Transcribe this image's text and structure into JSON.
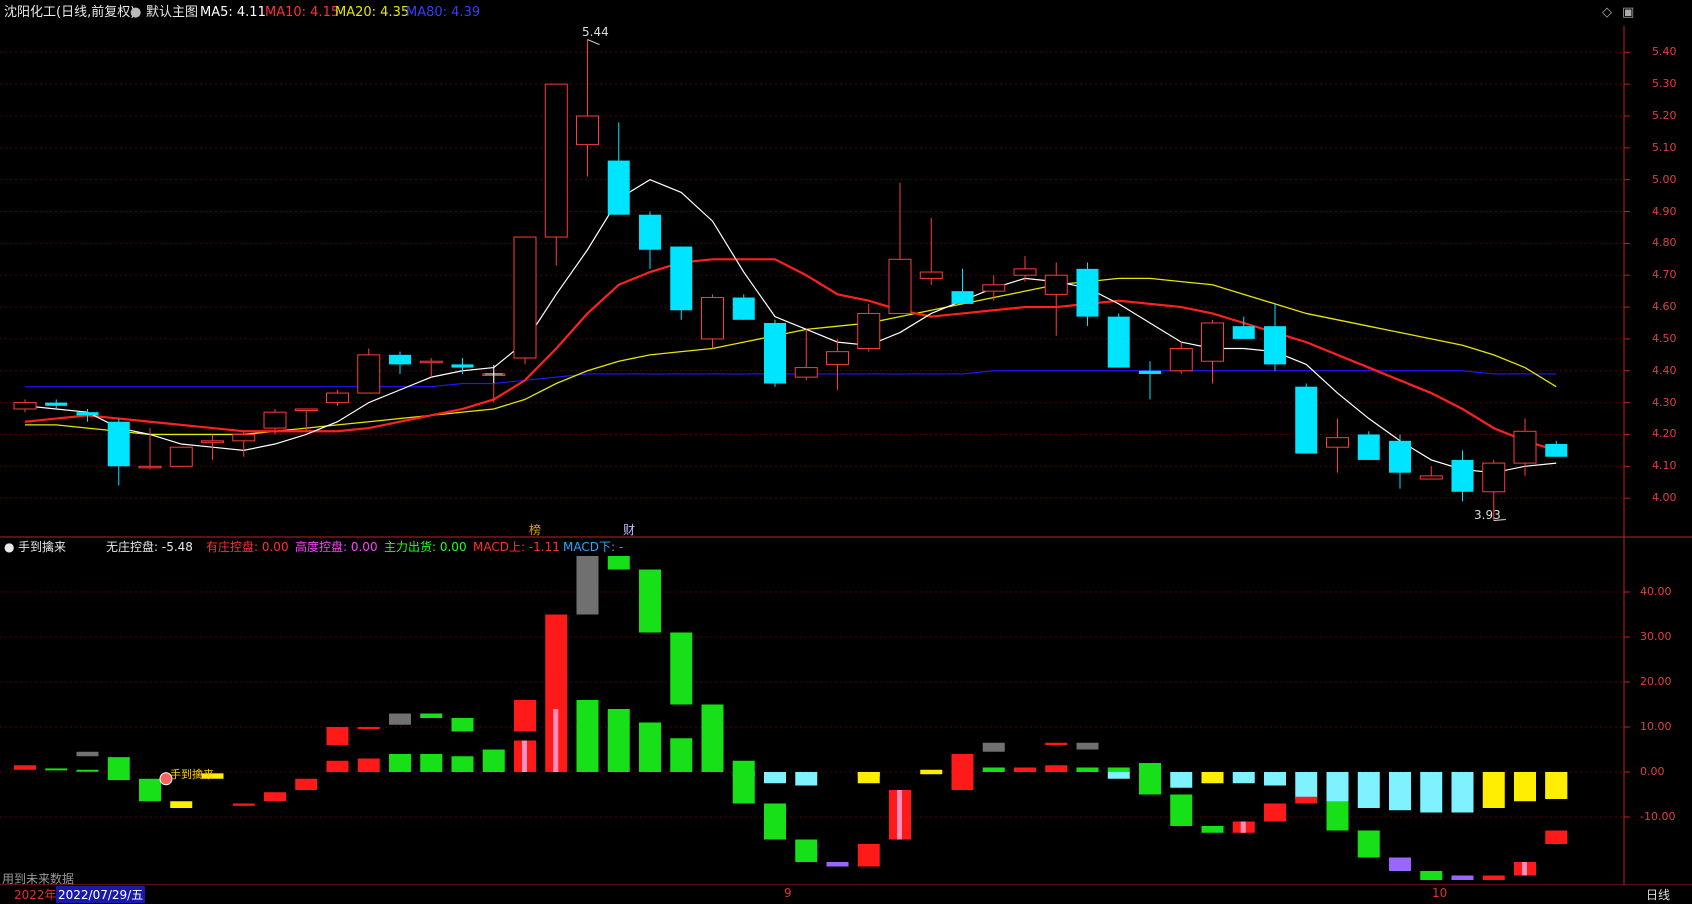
{
  "title_bar": {
    "stock": "沈阳化工(日线,前复权)",
    "main_chart": "默认主图",
    "ma5": "MA5: 4.11",
    "ma10": "MA10: 4.15",
    "ma20": "MA20: 4.35",
    "ma80": "MA80: 4.39"
  },
  "indicator_bar": {
    "name": "手到擒来",
    "wzk": "无庄控盘: -5.48",
    "yzk": "有庄控盘: 0.00",
    "gdk": "高度控盘: 0.00",
    "zlch": "主力出货: 0.00",
    "macd_up": "MACD上: -1.11",
    "macd_down": "MACD下: -"
  },
  "markers": {
    "bang": "榜",
    "cai": "财",
    "high": "5.44",
    "low": "3.93",
    "hand_label": "手到擒来"
  },
  "bottom": {
    "no_future": "用到未来数据",
    "year": "2022年",
    "date": "2022/07/29/五",
    "month9": "9",
    "month10": "10",
    "period": "日线"
  },
  "colors": {
    "up": "#ff3b3b",
    "down": "#00e5ff",
    "ma5": "#ffffff",
    "ma10": "#ff2020",
    "ma20": "#e6e600",
    "ma80": "#1a1aff",
    "axis": "#e04040"
  },
  "chart_data": [
    {
      "type": "candlestick",
      "title": "沈阳化工(日线,前复权)",
      "y_ticks": [
        "5.40",
        "5.30",
        "5.20",
        "5.10",
        "5.00",
        "4.90",
        "4.80",
        "4.70",
        "4.60",
        "4.50",
        "4.40",
        "4.30",
        "4.20",
        "4.10",
        "4.00"
      ],
      "ylim": [
        3.9,
        5.47
      ],
      "candles": [
        {
          "o": 4.28,
          "c": 4.3,
          "h": 4.31,
          "l": 4.27
        },
        {
          "o": 4.3,
          "c": 4.29,
          "h": 4.31,
          "l": 4.28
        },
        {
          "o": 4.27,
          "c": 4.26,
          "h": 4.28,
          "l": 4.24
        },
        {
          "o": 4.24,
          "c": 4.1,
          "h": 4.25,
          "l": 4.04
        },
        {
          "o": 4.1,
          "c": 4.1,
          "h": 4.22,
          "l": 4.09
        },
        {
          "o": 4.1,
          "c": 4.16,
          "h": 4.16,
          "l": 4.1
        },
        {
          "o": 4.18,
          "c": 4.18,
          "h": 4.2,
          "l": 4.12
        },
        {
          "o": 4.18,
          "c": 4.2,
          "h": 4.21,
          "l": 4.13
        },
        {
          "o": 4.22,
          "c": 4.27,
          "h": 4.28,
          "l": 4.2
        },
        {
          "o": 4.28,
          "c": 4.28,
          "h": 4.28,
          "l": 4.21
        },
        {
          "o": 4.3,
          "c": 4.33,
          "h": 4.34,
          "l": 4.29
        },
        {
          "o": 4.33,
          "c": 4.45,
          "h": 4.47,
          "l": 4.33
        },
        {
          "o": 4.45,
          "c": 4.42,
          "h": 4.46,
          "l": 4.39
        },
        {
          "o": 4.43,
          "c": 4.43,
          "h": 4.44,
          "l": 4.38
        },
        {
          "o": 4.42,
          "c": 4.41,
          "h": 4.44,
          "l": 4.39
        },
        {
          "o": 4.39,
          "c": 4.39,
          "h": 4.4,
          "l": 4.3
        },
        {
          "o": 4.44,
          "c": 4.82,
          "h": 4.82,
          "l": 4.42
        },
        {
          "o": 4.82,
          "c": 5.3,
          "h": 5.3,
          "l": 4.73
        },
        {
          "o": 5.11,
          "c": 5.2,
          "h": 5.44,
          "l": 5.01
        },
        {
          "o": 5.06,
          "c": 4.89,
          "h": 5.18,
          "l": 4.89
        },
        {
          "o": 4.89,
          "c": 4.78,
          "h": 4.9,
          "l": 4.72
        },
        {
          "o": 4.79,
          "c": 4.59,
          "h": 4.79,
          "l": 4.56
        },
        {
          "o": 4.5,
          "c": 4.63,
          "h": 4.64,
          "l": 4.47
        },
        {
          "o": 4.63,
          "c": 4.56,
          "h": 4.64,
          "l": 4.56
        },
        {
          "o": 4.55,
          "c": 4.36,
          "h": 4.56,
          "l": 4.35
        },
        {
          "o": 4.38,
          "c": 4.41,
          "h": 4.53,
          "l": 4.37
        },
        {
          "o": 4.42,
          "c": 4.46,
          "h": 4.5,
          "l": 4.34
        },
        {
          "o": 4.47,
          "c": 4.58,
          "h": 4.61,
          "l": 4.46
        },
        {
          "o": 4.58,
          "c": 4.75,
          "h": 4.99,
          "l": 4.58
        },
        {
          "o": 4.69,
          "c": 4.71,
          "h": 4.88,
          "l": 4.67
        },
        {
          "o": 4.65,
          "c": 4.61,
          "h": 4.72,
          "l": 4.61
        },
        {
          "o": 4.65,
          "c": 4.67,
          "h": 4.7,
          "l": 4.62
        },
        {
          "o": 4.7,
          "c": 4.72,
          "h": 4.76,
          "l": 4.68
        },
        {
          "o": 4.64,
          "c": 4.7,
          "h": 4.74,
          "l": 4.51
        },
        {
          "o": 4.72,
          "c": 4.57,
          "h": 4.74,
          "l": 4.54
        },
        {
          "o": 4.57,
          "c": 4.41,
          "h": 4.58,
          "l": 4.41
        },
        {
          "o": 4.4,
          "c": 4.39,
          "h": 4.43,
          "l": 4.31
        },
        {
          "o": 4.4,
          "c": 4.47,
          "h": 4.49,
          "l": 4.39
        },
        {
          "o": 4.43,
          "c": 4.55,
          "h": 4.56,
          "l": 4.36
        },
        {
          "o": 4.54,
          "c": 4.5,
          "h": 4.57,
          "l": 4.5
        },
        {
          "o": 4.54,
          "c": 4.42,
          "h": 4.61,
          "l": 4.4
        },
        {
          "o": 4.35,
          "c": 4.14,
          "h": 4.36,
          "l": 4.14
        },
        {
          "o": 4.16,
          "c": 4.19,
          "h": 4.25,
          "l": 4.08
        },
        {
          "o": 4.2,
          "c": 4.12,
          "h": 4.21,
          "l": 4.12
        },
        {
          "o": 4.18,
          "c": 4.08,
          "h": 4.2,
          "l": 4.03
        },
        {
          "o": 4.06,
          "c": 4.07,
          "h": 4.1,
          "l": 4.06
        },
        {
          "o": 4.12,
          "c": 4.02,
          "h": 4.15,
          "l": 3.99
        },
        {
          "o": 4.02,
          "c": 4.11,
          "h": 4.12,
          "l": 3.93
        },
        {
          "o": 4.11,
          "c": 4.21,
          "h": 4.25,
          "l": 4.07
        },
        {
          "o": 4.17,
          "c": 4.13,
          "h": 4.18,
          "l": 4.13
        }
      ],
      "ma5": [
        4.29,
        4.28,
        4.27,
        4.22,
        4.2,
        4.17,
        4.16,
        4.15,
        4.17,
        4.2,
        4.24,
        4.3,
        4.34,
        4.38,
        4.4,
        4.41,
        4.49,
        4.64,
        4.78,
        4.94,
        5.0,
        4.96,
        4.87,
        4.71,
        4.57,
        4.53,
        4.49,
        4.48,
        4.52,
        4.58,
        4.62,
        4.66,
        4.69,
        4.68,
        4.66,
        4.61,
        4.55,
        4.49,
        4.47,
        4.47,
        4.46,
        4.42,
        4.33,
        4.25,
        4.18,
        4.12,
        4.09,
        4.08,
        4.1,
        4.11
      ],
      "ma10": [
        4.24,
        4.25,
        4.26,
        4.25,
        4.24,
        4.23,
        4.22,
        4.21,
        4.21,
        4.21,
        4.21,
        4.22,
        4.24,
        4.26,
        4.28,
        4.31,
        4.37,
        4.47,
        4.58,
        4.67,
        4.71,
        4.74,
        4.75,
        4.75,
        4.75,
        4.7,
        4.64,
        4.62,
        4.59,
        4.57,
        4.58,
        4.59,
        4.6,
        4.6,
        4.61,
        4.62,
        4.61,
        4.6,
        4.58,
        4.55,
        4.52,
        4.49,
        4.45,
        4.41,
        4.37,
        4.33,
        4.28,
        4.22,
        4.18,
        4.15
      ],
      "ma20": [
        4.23,
        4.23,
        4.22,
        4.21,
        4.2,
        4.2,
        4.2,
        4.2,
        4.21,
        4.22,
        4.23,
        4.24,
        4.25,
        4.26,
        4.27,
        4.28,
        4.31,
        4.36,
        4.4,
        4.43,
        4.45,
        4.46,
        4.47,
        4.49,
        4.51,
        4.53,
        4.54,
        4.55,
        4.57,
        4.59,
        4.61,
        4.63,
        4.65,
        4.67,
        4.68,
        4.69,
        4.69,
        4.68,
        4.67,
        4.64,
        4.61,
        4.58,
        4.56,
        4.54,
        4.52,
        4.5,
        4.48,
        4.45,
        4.41,
        4.35
      ],
      "ma80": [
        4.35,
        4.35,
        4.35,
        4.35,
        4.35,
        4.35,
        4.35,
        4.35,
        4.35,
        4.35,
        4.35,
        4.35,
        4.35,
        4.35,
        4.36,
        4.36,
        4.37,
        4.38,
        4.39,
        4.39,
        4.39,
        4.39,
        4.39,
        4.39,
        4.39,
        4.39,
        4.39,
        4.39,
        4.39,
        4.39,
        4.39,
        4.4,
        4.4,
        4.4,
        4.4,
        4.4,
        4.4,
        4.4,
        4.4,
        4.4,
        4.4,
        4.4,
        4.4,
        4.4,
        4.4,
        4.4,
        4.4,
        4.39,
        4.39,
        4.39
      ]
    },
    {
      "type": "bar",
      "title": "手到擒来",
      "y_ticks": [
        "40.00",
        "30.00",
        "20.00",
        "10.00",
        "0.00",
        "-10.00"
      ],
      "ylim": [
        -24,
        48
      ],
      "bars": [
        {
          "v0": 0.5,
          "v1": 1.5,
          "c": "red"
        },
        {
          "v0": 0.5,
          "v1": 0.8,
          "c": "green"
        },
        {
          "v0": 0.3,
          "v1": 0.5,
          "c": "green"
        },
        {
          "v0": -1.8,
          "v1": 3.3,
          "c": "green"
        },
        {
          "v0": -6.5,
          "v1": -1.5,
          "c": "green"
        },
        {
          "v0": -8,
          "v1": -6.5,
          "c": "yellow"
        },
        {
          "v0": -0.3,
          "v1": -1.5,
          "c": "yellow"
        },
        {
          "v0": -7.5,
          "v1": -7,
          "c": "red"
        },
        {
          "v0": -6.5,
          "v1": -4.5,
          "c": "red"
        },
        {
          "v0": -4,
          "v1": -1.5,
          "c": "red"
        },
        {
          "v0": 0,
          "v1": 2.5,
          "c": "red"
        },
        {
          "v0": 0,
          "v1": 3,
          "c": "red"
        },
        {
          "v0": 0,
          "v1": 4,
          "c": "green"
        },
        {
          "v0": 0,
          "v1": 4,
          "c": "green"
        },
        {
          "v0": 0,
          "v1": 3.5,
          "c": "green"
        },
        {
          "v0": 0,
          "v1": 5,
          "c": "green"
        },
        {
          "v0": 0,
          "v1": 7,
          "c": "red"
        },
        {
          "v0": 0,
          "v1": 14,
          "c": "red"
        },
        {
          "v0": 0,
          "v1": 16,
          "c": "green"
        },
        {
          "v0": 0,
          "v1": 14,
          "c": "green"
        },
        {
          "v0": 0,
          "v1": 11,
          "c": "green"
        },
        {
          "v0": 0,
          "v1": 7.5,
          "c": "green"
        },
        {
          "v0": 0,
          "v1": 5,
          "c": "green"
        },
        {
          "v0": -7,
          "v1": 2.5,
          "c": "green"
        },
        {
          "v0": -15,
          "v1": -7,
          "c": "green"
        },
        {
          "v0": -20,
          "v1": -15,
          "c": "green"
        },
        {
          "v0": -21,
          "v1": -20,
          "c": "purple"
        },
        {
          "v0": -21,
          "v1": -16,
          "c": "red"
        },
        {
          "v0": -15,
          "v1": -4,
          "c": "red"
        },
        {
          "v0": -0.5,
          "v1": 0.5,
          "c": "yellow"
        },
        {
          "v0": -4,
          "v1": 4,
          "c": "red"
        },
        {
          "v0": 0,
          "v1": 1,
          "c": "green"
        },
        {
          "v0": 0,
          "v1": 1,
          "c": "red"
        },
        {
          "v0": 0,
          "v1": 1.5,
          "c": "red"
        },
        {
          "v0": 0,
          "v1": 1,
          "c": "green"
        },
        {
          "v0": 0,
          "v1": 1,
          "c": "green"
        },
        {
          "v0": -5,
          "v1": 2,
          "c": "green"
        },
        {
          "v0": -12,
          "v1": -5,
          "c": "green"
        },
        {
          "v0": -13.5,
          "v1": -12,
          "c": "green"
        },
        {
          "v0": -13.5,
          "v1": -11,
          "c": "red"
        },
        {
          "v0": -11,
          "v1": -7,
          "c": "red"
        },
        {
          "v0": -7,
          "v1": -5.5,
          "c": "red"
        },
        {
          "v0": -13,
          "v1": -6.5,
          "c": "green"
        },
        {
          "v0": -19,
          "v1": -13,
          "c": "green"
        },
        {
          "v0": -22,
          "v1": -19,
          "c": "purple"
        },
        {
          "v0": -24,
          "v1": -22,
          "c": "green"
        },
        {
          "v0": -24,
          "v1": -23,
          "c": "purple"
        },
        {
          "v0": -24,
          "v1": -23,
          "c": "red"
        },
        {
          "v0": -23,
          "v1": -20,
          "c": "red"
        },
        {
          "v0": -16,
          "v1": -13,
          "c": "red"
        }
      ],
      "cyan_bars": [
        {
          "i": 23,
          "v": -1
        },
        {
          "i": 24,
          "v": -2.5
        },
        {
          "i": 25,
          "v": -3
        },
        {
          "i": 27,
          "v": -1
        },
        {
          "i": 35,
          "v": -1.5
        },
        {
          "i": 36,
          "v": -3.5
        },
        {
          "i": 37,
          "v": -3.5
        },
        {
          "i": 39,
          "v": -2.5
        },
        {
          "i": 40,
          "v": -3
        },
        {
          "i": 41,
          "v": -6
        },
        {
          "i": 42,
          "v": -7
        },
        {
          "i": 43,
          "v": -8
        },
        {
          "i": 44,
          "v": -8.5
        },
        {
          "i": 45,
          "v": -9
        },
        {
          "i": 46,
          "v": -9
        },
        {
          "i": 48,
          "v": -6
        },
        {
          "i": 49,
          "v": -6
        }
      ],
      "yellow_neg": [
        {
          "i": 27,
          "v": -2.5
        },
        {
          "i": 38,
          "v": -2.5
        },
        {
          "i": 47,
          "v": -8
        },
        {
          "i": 48,
          "v": -6.5
        },
        {
          "i": 49,
          "v": -6
        }
      ],
      "gray_bars": [
        {
          "i": 2,
          "v0": 3.5,
          "v1": 4.5
        },
        {
          "i": 12,
          "v0": 10.5,
          "v1": 13
        },
        {
          "i": 18,
          "v0": 35,
          "v1": 48
        },
        {
          "i": 31,
          "v0": 4.5,
          "v1": 6.5
        },
        {
          "i": 34,
          "v0": 5,
          "v1": 6.5
        }
      ],
      "top_green": [
        {
          "i": 19,
          "v0": 45,
          "v1": 48
        },
        {
          "i": 20,
          "v0": 31,
          "v1": 45
        },
        {
          "i": 21,
          "v0": 15,
          "v1": 31
        },
        {
          "i": 22,
          "v0": 5,
          "v1": 15
        },
        {
          "i": 14,
          "v0": 9,
          "v1": 12
        },
        {
          "i": 13,
          "v0": 12,
          "v1": 13
        }
      ],
      "top_red": [
        {
          "i": 16,
          "v0": 9,
          "v1": 16
        },
        {
          "i": 17,
          "v0": 14,
          "v1": 35
        },
        {
          "i": 11,
          "v0": 10,
          "v1": 10
        },
        {
          "i": 10,
          "v0": 6,
          "v1": 10
        },
        {
          "i": 33,
          "v0": 6,
          "v1": 6.5
        }
      ]
    }
  ]
}
